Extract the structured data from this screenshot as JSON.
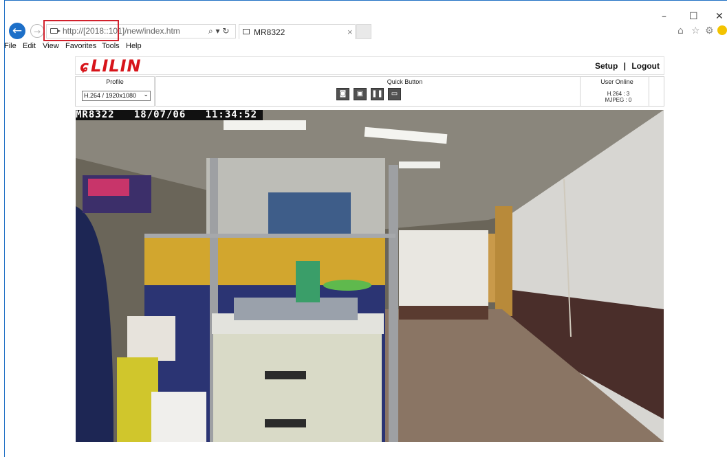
{
  "browser": {
    "url": "http://[2018::101]/new/index.htm",
    "search_icon": "⌕ ▾ ↻",
    "tab_title": "MR8322",
    "tab_close": "×",
    "window_controls": [
      "–",
      "☐",
      "✕"
    ],
    "toolbar_icons": [
      "home-icon",
      "star-icon",
      "gear-icon",
      "smiley-icon"
    ],
    "menu": [
      "File",
      "Edit",
      "View",
      "Favorites",
      "Tools",
      "Help"
    ]
  },
  "page": {
    "logo_text": "LILIN",
    "links": {
      "setup": "Setup",
      "separator": "|",
      "logout": "Logout"
    },
    "profile": {
      "label": "Profile",
      "selected": "H.264 / 1920x1080"
    },
    "quick_button": {
      "label": "Quick Button",
      "buttons": [
        "snapshot-icon",
        "record-icon",
        "pause-icon",
        "fullscreen-icon"
      ]
    },
    "user_online": {
      "label": "User Online",
      "h264": "H.264 : 3",
      "mjpeg": "MJPEG : 0"
    },
    "video": {
      "osd": "MR8322   18/07/06   11:34:52"
    }
  },
  "colors": {
    "accent": "#1d6fc8",
    "brand": "#d7141a",
    "highlight": "#d1202b"
  }
}
